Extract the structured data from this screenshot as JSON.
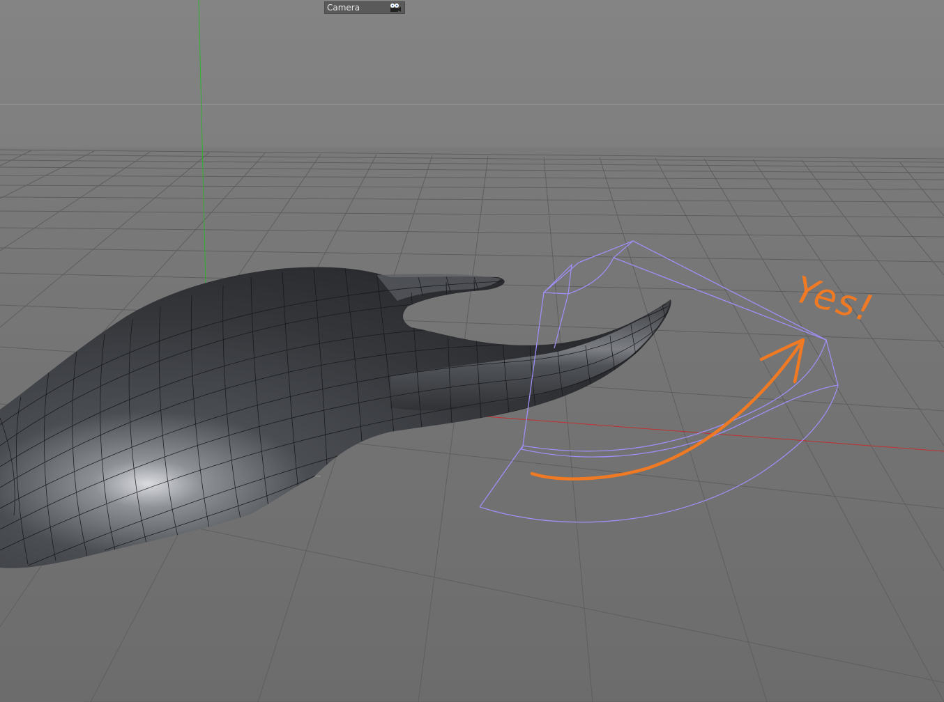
{
  "viewport": {
    "camera_label": "Camera",
    "camera_icon": "camera-icon",
    "annotation": {
      "text": "Yes!",
      "color": "#f07a23"
    },
    "colors": {
      "grid_line": "#5e5e5e",
      "x_axis": "#c23030",
      "y_axis": "#2fb32f",
      "bend_deformer": "#9d8ff5",
      "mesh_surface": "#3b3d40",
      "mesh_wire": "#16181a"
    }
  }
}
